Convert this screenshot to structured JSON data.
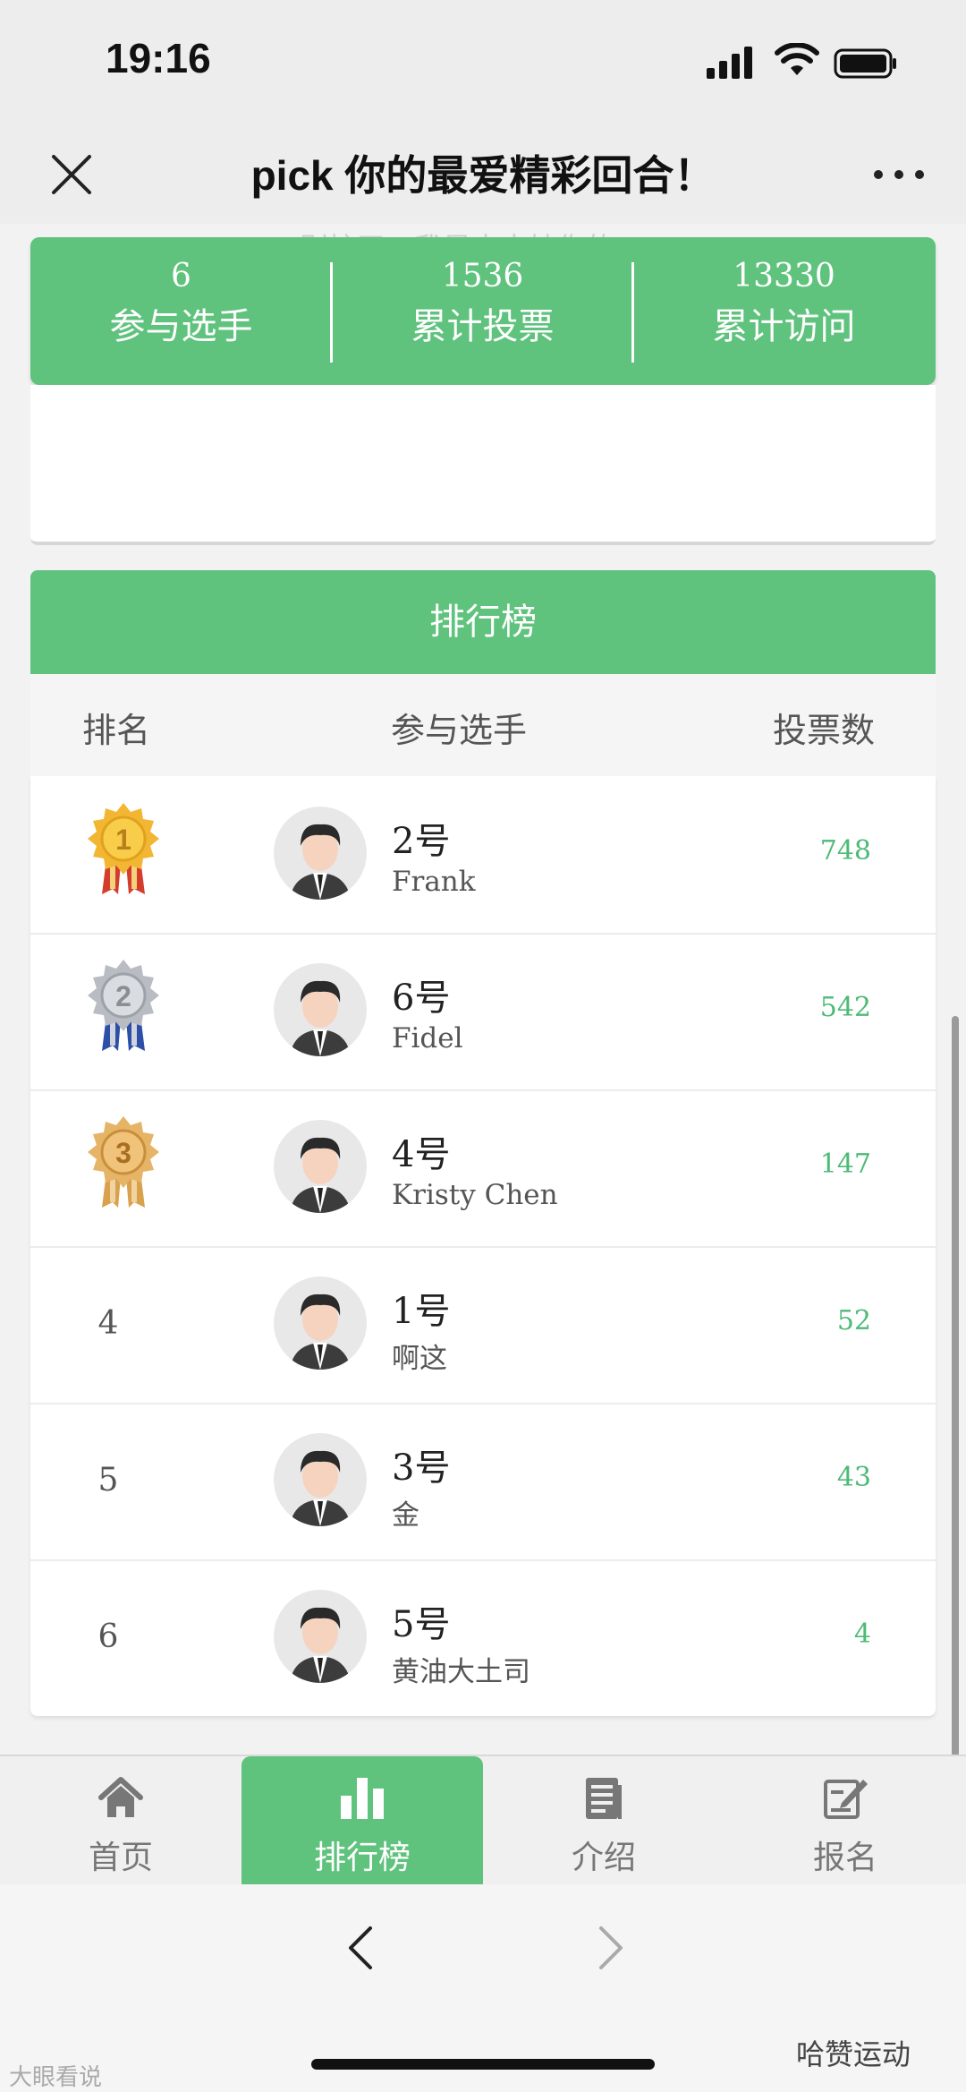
{
  "status_bar": {
    "time": "19:16"
  },
  "nav": {
    "title": "pick 你的最爱精彩回合！"
  },
  "ghost_text": "别忙了，我是来支持你的",
  "stats": [
    {
      "value": "6",
      "label": "参与选手"
    },
    {
      "value": "1536",
      "label": "累计投票"
    },
    {
      "value": "13330",
      "label": "累计访问"
    }
  ],
  "leaderboard": {
    "title": "排行榜",
    "columns": {
      "rank": "排名",
      "player": "参与选手",
      "votes": "投票数"
    },
    "rows": [
      {
        "rank": "1",
        "medal": "gold",
        "number": "2号",
        "name": "Frank",
        "votes": "748"
      },
      {
        "rank": "2",
        "medal": "silver",
        "number": "6号",
        "name": "Fidel",
        "votes": "542"
      },
      {
        "rank": "3",
        "medal": "bronze",
        "number": "4号",
        "name": "Kristy Chen",
        "votes": "147"
      },
      {
        "rank": "4",
        "number": "1号",
        "name": "啊这",
        "votes": "52"
      },
      {
        "rank": "5",
        "number": "3号",
        "name": "金",
        "votes": "43"
      },
      {
        "rank": "6",
        "number": "5号",
        "name": "黄油大土司",
        "votes": "4"
      }
    ]
  },
  "tabs": [
    {
      "label": "首页",
      "icon": "home-icon"
    },
    {
      "label": "排行榜",
      "icon": "bar-chart-icon",
      "active": true
    },
    {
      "label": "介绍",
      "icon": "document-icon"
    },
    {
      "label": "报名",
      "icon": "edit-icon"
    }
  ],
  "watermarks": {
    "left": "大眼看说",
    "right": "哈赞运动"
  },
  "colors": {
    "accent": "#5fc27d",
    "votes": "#4dba76",
    "gold": "#f2b632",
    "silver": "#b9bcc2",
    "bronze": "#d9a14b"
  }
}
